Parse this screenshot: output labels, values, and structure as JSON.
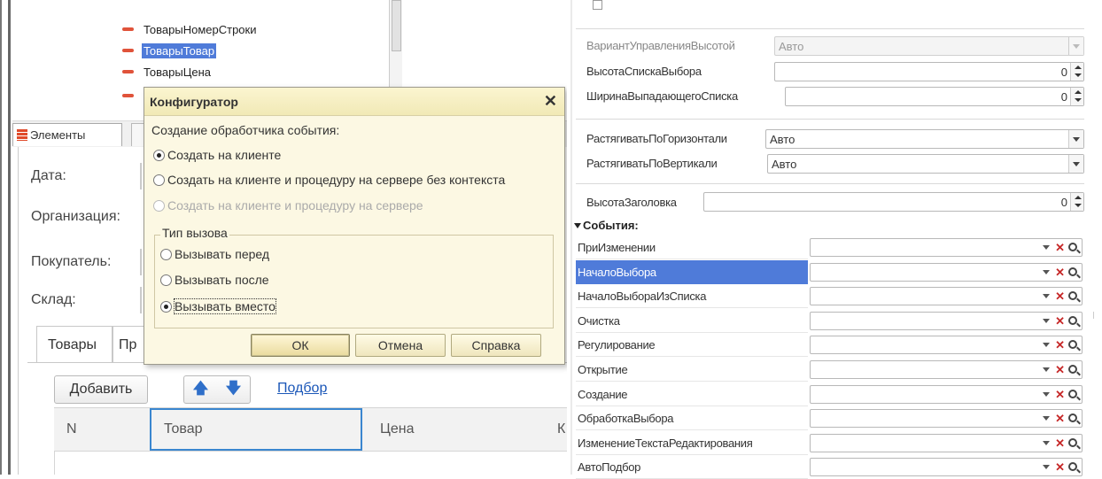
{
  "tree": {
    "items": [
      {
        "label": "ТоварыНомерСтроки",
        "selected": false
      },
      {
        "label": "ТоварыТовар",
        "selected": true
      },
      {
        "label": "ТоварыЦена",
        "selected": false
      }
    ],
    "tab_elements": "Элементы"
  },
  "form": {
    "fields": [
      "Дата:",
      "Организация:",
      "Покупатель:",
      "Склад:"
    ],
    "tabs": [
      "Товары",
      "Пр"
    ],
    "add_button": "Добавить",
    "pick_link": "Подбор",
    "grid_columns": [
      "N",
      "Товар",
      "Цена",
      "К"
    ]
  },
  "dialog": {
    "title": "Конфигуратор",
    "close": "✕",
    "prompt": "Создание обработчика события:",
    "create_options": [
      {
        "label": "Создать на клиенте",
        "checked": true,
        "enabled": true
      },
      {
        "label": "Создать на клиенте и процедуру на сервере без контекста",
        "checked": false,
        "enabled": true
      },
      {
        "label": "Создать на клиенте и процедуру на сервере",
        "checked": false,
        "enabled": false
      }
    ],
    "call_type_title": "Тип вызова",
    "call_type_options": [
      {
        "label": "Вызывать перед",
        "checked": false
      },
      {
        "label": "Вызывать после",
        "checked": false
      },
      {
        "label": "Вызывать вместо",
        "checked": true
      }
    ],
    "buttons": {
      "ok": "ОК",
      "cancel": "Отмена",
      "help": "Справка"
    }
  },
  "properties": {
    "height_mode": {
      "label": "ВариантУправленияВысотой",
      "value": "Авто"
    },
    "choice_list_height": {
      "label": "ВысотаСпискаВыбора",
      "value": "0"
    },
    "dropdown_width": {
      "label": "ШиринаВыпадающегоСписка",
      "value": "0"
    },
    "stretch_h": {
      "label": "РастягиватьПоГоризонтали",
      "value": "Авто"
    },
    "stretch_v": {
      "label": "РастягиватьПоВертикали",
      "value": "Авто"
    },
    "header_height": {
      "label": "ВысотаЗаголовка",
      "value": "0"
    }
  },
  "events": {
    "title": "События:",
    "items": [
      {
        "label": "ПриИзменении",
        "selected": false
      },
      {
        "label": "НачалоВыбора",
        "selected": true
      },
      {
        "label": "НачалоВыбораИзСписка",
        "selected": false
      },
      {
        "label": "Очистка",
        "selected": false
      },
      {
        "label": "Регулирование",
        "selected": false
      },
      {
        "label": "Открытие",
        "selected": false
      },
      {
        "label": "Создание",
        "selected": false
      },
      {
        "label": "ОбработкаВыбора",
        "selected": false
      },
      {
        "label": "ИзменениеТекстаРедактирования",
        "selected": false
      },
      {
        "label": "АвтоПодбор",
        "selected": false
      }
    ]
  },
  "colors": {
    "selection": "#4f7bd9",
    "dialog_bg": "#fcf8e3",
    "clear_icon": "#c62828",
    "focus_frame": "#3a86cf"
  }
}
